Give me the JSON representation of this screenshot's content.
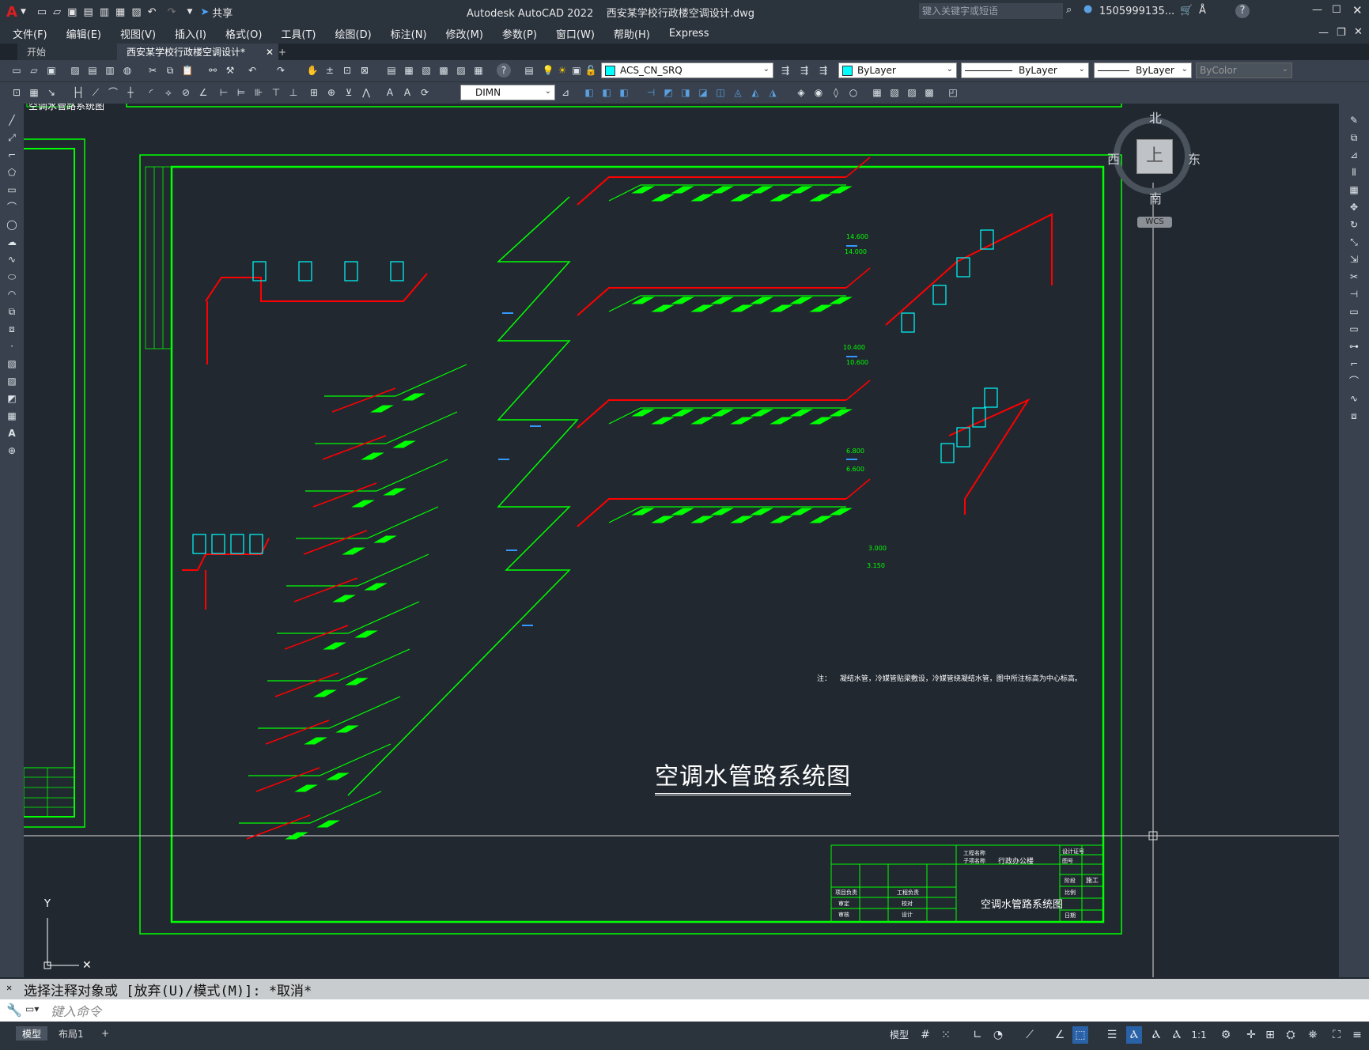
{
  "titlebar": {
    "app_letter": "A",
    "share_label": "共享",
    "title": "Autodesk AutoCAD 2022    西安某学校行政楼空调设计.dwg",
    "search_placeholder": "键入关键字或短语",
    "user": "1505999135...",
    "help": "?"
  },
  "menu": [
    "文件(F)",
    "编辑(E)",
    "视图(V)",
    "插入(I)",
    "格式(O)",
    "工具(T)",
    "绘图(D)",
    "标注(N)",
    "修改(M)",
    "参数(P)",
    "窗口(W)",
    "帮助(H)",
    "Express"
  ],
  "tabs": {
    "start": "开始",
    "doc": "西安某学校行政楼空调设计*",
    "add": "+"
  },
  "toolbar": {
    "layer": "ACS_CN_SRQ",
    "color": "ByLayer",
    "linetype": "ByLayer",
    "lineweight": "ByLayer",
    "plotstyle": "ByColor",
    "dimstyle": "DIMN"
  },
  "viewcube": {
    "north": "北",
    "south": "南",
    "east": "东",
    "west": "西",
    "face": "上",
    "wcs": "WCS"
  },
  "drawing": {
    "main_title": "空调水管路系统图",
    "note_label": "注：",
    "note_text": "凝结水管，冷媒管贴梁敷设，冷媒管绕凝结水管，图中所注标高为中心标高。",
    "titleblock": {
      "project_name_label": "工程名称",
      "sub_label": "子项名称",
      "project_name": "行政办公楼",
      "drawing_name": "空调水管路系统图",
      "design_no_label": "设计证号",
      "drawing_no_label": "图号",
      "phase_label": "阶段",
      "phase": "施工",
      "scale_label": "比例",
      "date_label": "日期",
      "chief_label": "项目负责",
      "check_label": "审定",
      "review_label": "审核",
      "prof_label": "工程负责",
      "proofread_label": "校对",
      "design_label": "设计"
    },
    "elevations": [
      "14.000",
      "14.600",
      "10.600",
      "10.400",
      "6.800",
      "6.600",
      "3.150",
      "3.000"
    ],
    "partial_header": "空调水管路系统图"
  },
  "command": {
    "history": "选择注释对象或 [放弃(U)/模式(M)]: *取消*",
    "placeholder": "键入命令"
  },
  "status": {
    "model_tab": "模型",
    "layout_tab": "布局1",
    "add": "+",
    "model_label": "模型",
    "scale": "1:1"
  },
  "colors": {
    "green": "#00ff00",
    "red": "#ff0000",
    "cyan": "#00ffff",
    "blue": "#3399ff",
    "canvas": "#212830",
    "ribbon": "#38414d"
  }
}
